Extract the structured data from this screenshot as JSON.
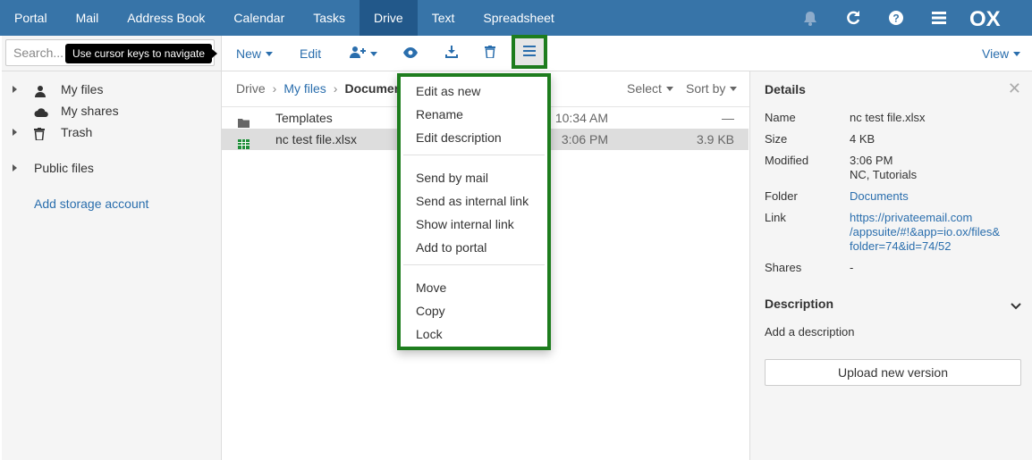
{
  "topbar": {
    "apps": [
      "Portal",
      "Mail",
      "Address Book",
      "Calendar",
      "Tasks",
      "Drive",
      "Text",
      "Spreadsheet"
    ],
    "active_app": "Drive",
    "icons": [
      "bell-icon",
      "refresh-icon",
      "help-icon",
      "menu-icon"
    ],
    "logo": "OX",
    "colors": {
      "bar": "#3774a8",
      "active": "#22588a"
    }
  },
  "search": {
    "placeholder": "Search...",
    "tooltip": "Use cursor keys to navigate"
  },
  "folder_tree": {
    "items": [
      {
        "label": "My files",
        "icon": "user-icon",
        "expandable": true
      },
      {
        "label": "My shares",
        "icon": "cloud-icon",
        "expandable": false
      },
      {
        "label": "Trash",
        "icon": "trash-icon",
        "expandable": true
      },
      {
        "label": "Public files",
        "icon": "",
        "expandable": true
      }
    ],
    "add_storage": "Add storage account"
  },
  "toolbar": {
    "new_label": "New",
    "edit_label": "Edit",
    "share_icon": "add-user-icon",
    "view_icon": "eye-icon",
    "download_icon": "download-icon",
    "delete_icon": "trash-icon",
    "more_icon": "menu-icon",
    "view_label": "View"
  },
  "breadcrumb": {
    "items": [
      "Drive",
      "My files",
      "Documen"
    ]
  },
  "list_controls": {
    "select_label": "Select",
    "sort_label": "Sort by"
  },
  "files": [
    {
      "name": "Templates",
      "date": "10:34 AM",
      "size": "—",
      "icon": "folder-icon",
      "selected": false
    },
    {
      "name": "nc test file.xlsx",
      "date": "3:06 PM",
      "size": "3.9 KB",
      "icon": "spreadsheet-icon",
      "selected": true
    }
  ],
  "more_menu": {
    "groups": [
      [
        "Edit as new",
        "Rename",
        "Edit description"
      ],
      [
        "Send by mail",
        "Send as internal link",
        "Show internal link",
        "Add to portal"
      ],
      [
        "Move",
        "Copy",
        "Lock"
      ]
    ],
    "highlight_color": "#1e7d1e"
  },
  "details": {
    "title": "Details",
    "name_k": "Name",
    "name_v": "nc test file.xlsx",
    "size_k": "Size",
    "size_v": "4 KB",
    "modified_k": "Modified",
    "modified_v1": "3:06 PM",
    "modified_v2": "NC, Tutorials",
    "folder_k": "Folder",
    "folder_v": "Documents",
    "link_k": "Link",
    "link_v1": "https://privateemail.com",
    "link_v2": "/appsuite/#!&app=io.ox/files&",
    "link_v3": "folder=74&id=74/52",
    "shares_k": "Shares",
    "shares_v": "-",
    "description_title": "Description",
    "add_description": "Add a description",
    "upload_label": "Upload new version"
  }
}
